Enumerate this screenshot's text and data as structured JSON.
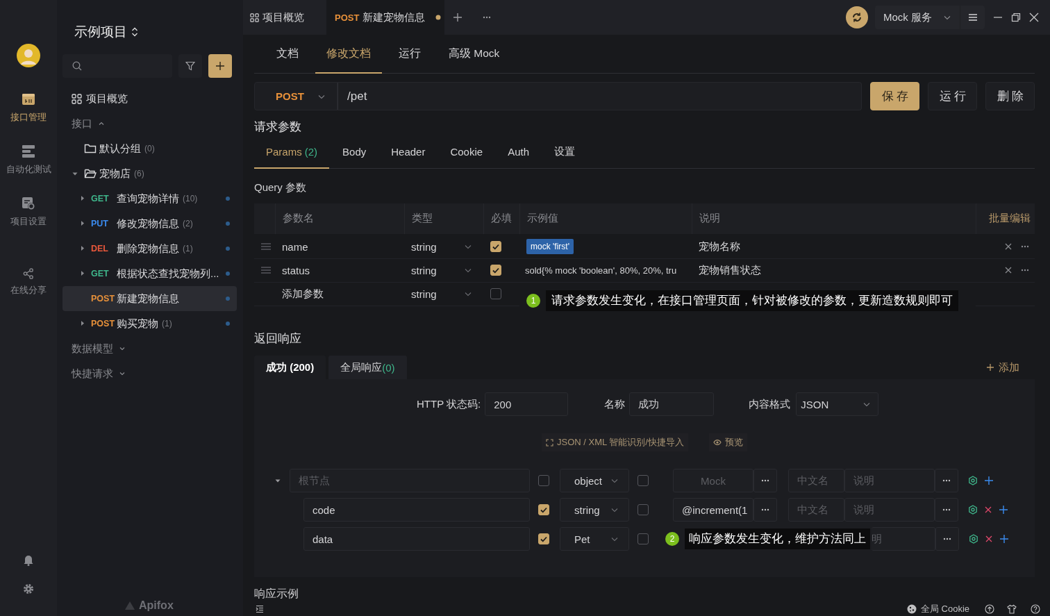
{
  "rail": {
    "items": [
      {
        "kind": "api",
        "label": "接口管理",
        "selected": true
      },
      {
        "kind": "test",
        "label": "自动化测试",
        "selected": false
      },
      {
        "kind": "settings",
        "label": "项目设置",
        "selected": false
      },
      {
        "kind": "share",
        "label": "在线分享",
        "selected": false
      }
    ]
  },
  "sidebar": {
    "project": "示例项目",
    "brand": "Apifox",
    "tree": [
      {
        "kind": "overview",
        "label": "项目概览"
      },
      {
        "kind": "section",
        "label": "接口",
        "expanded": true,
        "children": [
          {
            "kind": "folder",
            "label": "默认分组",
            "count": "(0)",
            "expanded": false
          },
          {
            "kind": "folder",
            "label": "宠物店",
            "count": "(6)",
            "expanded": true,
            "children": [
              {
                "kind": "endpoint",
                "method": "GET",
                "color": "#3fb68b",
                "label": "查询宠物详情",
                "count": "(10)",
                "expandable": true,
                "selected": false
              },
              {
                "kind": "endpoint",
                "method": "PUT",
                "color": "#3b8cf0",
                "label": "修改宠物信息",
                "count": "(2)",
                "expandable": true,
                "selected": false
              },
              {
                "kind": "endpoint",
                "method": "DEL",
                "color": "#e8573b",
                "label": "删除宠物信息",
                "count": "(1)",
                "expandable": true,
                "selected": false
              },
              {
                "kind": "endpoint",
                "method": "GET",
                "color": "#3fb68b",
                "label": "根据状态查找宠物列...",
                "expandable": true,
                "selected": false
              },
              {
                "kind": "endpoint",
                "method": "POST",
                "color": "#e8913a",
                "label": "新建宠物信息",
                "expandable": false,
                "selected": true
              },
              {
                "kind": "endpoint",
                "method": "POST",
                "color": "#e8913a",
                "label": "购买宠物",
                "count": "(1)",
                "expandable": true,
                "selected": false
              }
            ]
          }
        ]
      },
      {
        "kind": "section",
        "label": "数据模型",
        "expanded": false
      },
      {
        "kind": "section",
        "label": "快捷请求",
        "expanded": false
      }
    ]
  },
  "tabs": [
    {
      "kind": "overview",
      "label": "项目概览",
      "selected": false
    },
    {
      "kind": "endpoint",
      "method": "POST",
      "label": "新建宠物信息",
      "unsaved": true,
      "selected": true
    }
  ],
  "toolbar": {
    "mock_service": "Mock 服务"
  },
  "doc_tabs": [
    {
      "label": "文档",
      "selected": false
    },
    {
      "label": "修改文档",
      "selected": true
    },
    {
      "label": "运行",
      "selected": false
    },
    {
      "label": "高级 Mock",
      "selected": false
    }
  ],
  "request": {
    "method": "POST",
    "path": "/pet",
    "actions": [
      {
        "label": "保存",
        "primary": true
      },
      {
        "label": "运行",
        "primary": false
      },
      {
        "label": "删除",
        "primary": false
      }
    ]
  },
  "params": {
    "title": "请求参数",
    "tabs": [
      {
        "label": "Params",
        "count": "(2)",
        "selected": true
      },
      {
        "label": "Body",
        "selected": false
      },
      {
        "label": "Header",
        "selected": false
      },
      {
        "label": "Cookie",
        "selected": false
      },
      {
        "label": "Auth",
        "selected": false
      },
      {
        "label": "设置",
        "selected": false
      }
    ],
    "query_title": "Query 参数",
    "columns": [
      "参数名",
      "类型",
      "必填",
      "示例值",
      "说明"
    ],
    "bulk_edit": "批量编辑",
    "rows": [
      {
        "name": "name",
        "type": "string",
        "required": true,
        "example": {
          "kind": "tag",
          "text": "mock 'first'"
        },
        "description": "宠物名称"
      },
      {
        "name": "status",
        "type": "string",
        "required": true,
        "example": {
          "kind": "text",
          "text": "sold{% mock 'boolean', 80%, 20%, tru"
        },
        "description": "宠物销售状态"
      }
    ],
    "new_row": {
      "placeholder": "添加参数",
      "type": "string",
      "required": false
    },
    "callout": {
      "number": "1",
      "text": "请求参数发生变化，在接口管理页面，针对被修改的参数，更新造数规则即可"
    }
  },
  "response": {
    "title": "返回响应",
    "tabs": [
      {
        "label": "成功 (200)",
        "selected": true
      },
      {
        "label": "全局响应",
        "count": "(0)",
        "selected": false
      }
    ],
    "add": "添加",
    "status_label": "HTTP 状态码:",
    "status": "200",
    "name_label": "名称",
    "name": "成功",
    "format_label": "内容格式",
    "format": "JSON",
    "import_link": "JSON / XML 智能识别/快捷导入",
    "preview_link": "预览",
    "schema": {
      "name_placeholder": "根节点",
      "type": "object",
      "required": false,
      "nullable": false,
      "mock_placeholder": "Mock",
      "cn_placeholder": "中文名",
      "desc_placeholder": "说明",
      "expanded": true,
      "children": [
        {
          "name": "code",
          "type": "string",
          "required": true,
          "nullable": false,
          "mock": "@increment(1",
          "cn_placeholder": "中文名",
          "desc_placeholder": "说明"
        },
        {
          "name": "data",
          "type": "Pet",
          "required": true,
          "nullable": false,
          "desc_visible": "明",
          "callout": {
            "number": "2",
            "text": "响应参数发生变化，维护方法同上"
          }
        }
      ]
    },
    "example_title": "响应示例"
  },
  "status_bar": {
    "cookie": "全局 Cookie"
  }
}
